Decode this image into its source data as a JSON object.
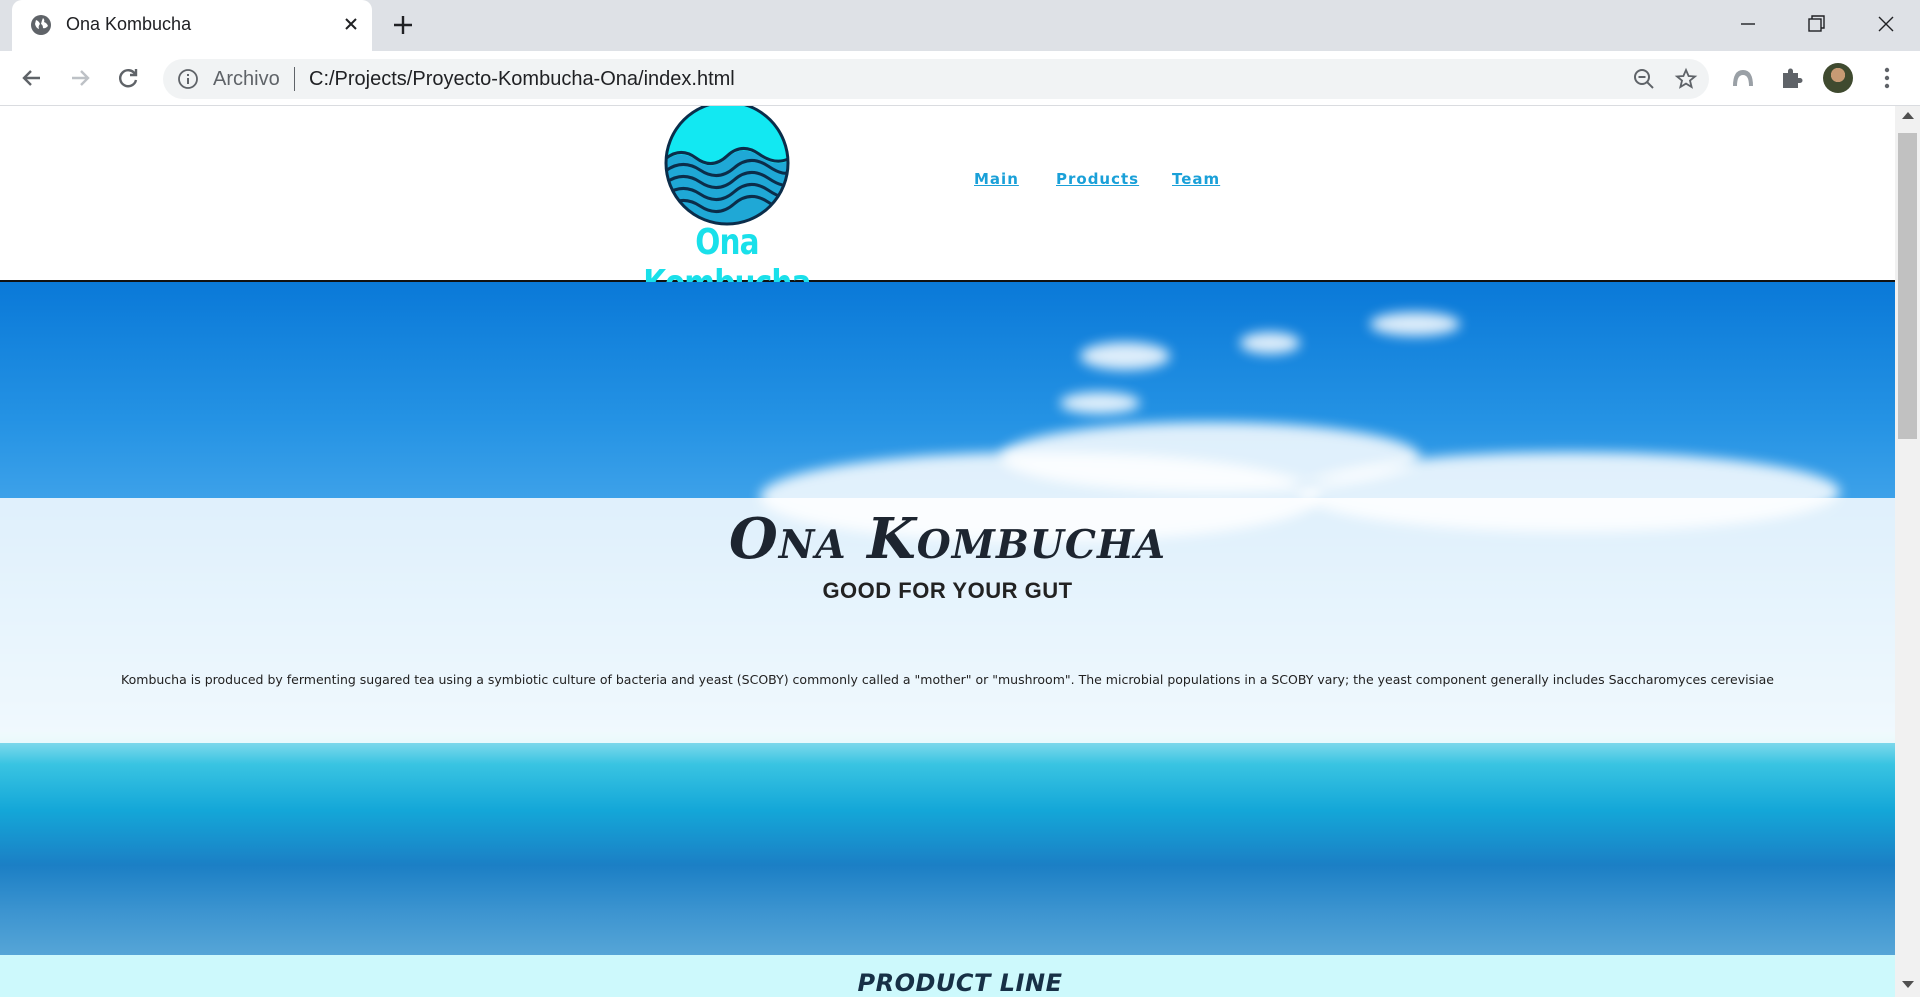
{
  "browser": {
    "tab_title": "Ona Kombucha",
    "omnibox_scheme": "Archivo",
    "url": "C:/Projects/Proyecto-Kombucha-Ona/index.html"
  },
  "site": {
    "logo_text": "Ona Kombucha",
    "nav": [
      "Main",
      "Products",
      "Team"
    ],
    "hero_title": "Ona Kombucha",
    "hero_subtitle": "GOOD FOR YOUR GUT",
    "hero_description": "Kombucha is produced by fermenting sugared tea using a symbiotic culture of bacteria and yeast (SCOBY) commonly called a \"mother\" or \"mushroom\". The microbial populations in a SCOBY vary; the yeast component generally includes Saccharomyces cerevisiae",
    "section_title": "PRODUCT LINE"
  },
  "colors": {
    "brand_cyan": "#19e0ea",
    "nav_link": "#1aa0d8",
    "product_band": "#cdf9fc"
  },
  "icons": [
    "globe-icon",
    "close-icon",
    "plus-icon",
    "minimize-icon",
    "restore-icon",
    "back-icon",
    "forward-icon",
    "reload-icon",
    "info-icon",
    "zoom-out-icon",
    "star-icon",
    "extension-arc-icon",
    "puzzle-icon",
    "more-icon"
  ]
}
